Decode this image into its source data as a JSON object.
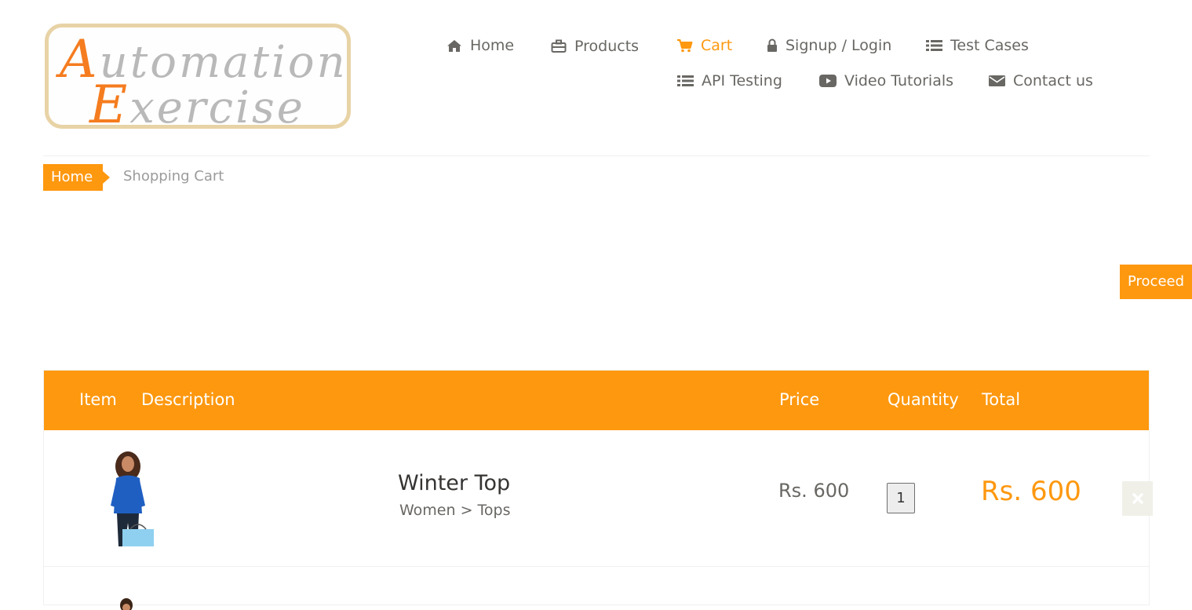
{
  "brand": {
    "logo_line1_cap": "A",
    "logo_line1_rest": "utomation",
    "logo_line2_cap": "E",
    "logo_line2_rest": "xercise"
  },
  "nav": {
    "home": "Home",
    "products": "Products",
    "cart": "Cart",
    "signup_login": "Signup / Login",
    "test_cases": "Test Cases",
    "api_testing": "API Testing",
    "video_tutorials": "Video Tutorials",
    "contact_us": "Contact us"
  },
  "breadcrumb": {
    "home": "Home",
    "current": "Shopping Cart"
  },
  "proceed_button": "Proceed",
  "table": {
    "headers": {
      "item": "Item",
      "description": "Description",
      "price": "Price",
      "quantity": "Quantity",
      "total": "Total"
    },
    "rows": [
      {
        "name": "Winter Top",
        "category": "Women > Tops",
        "price": "Rs. 600",
        "quantity": "1",
        "total": "Rs. 600"
      }
    ]
  },
  "colors": {
    "accent": "#fe980f",
    "text": "#696763",
    "logo_orange": "#f57c1f"
  },
  "icons": [
    "home-icon",
    "briefcase-icon",
    "cart-icon",
    "lock-icon",
    "list-icon",
    "youtube-play-icon",
    "envelope-icon",
    "delete-x-icon"
  ]
}
